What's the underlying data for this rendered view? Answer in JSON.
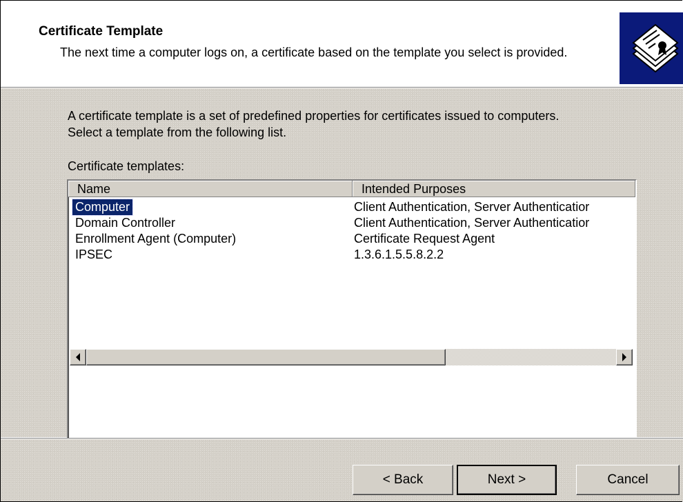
{
  "header": {
    "title": "Certificate Template",
    "subtitle": "The next time a computer logs on, a certificate based on the template you select is provided.",
    "icon": "certificate-stack-icon"
  },
  "main": {
    "intro": "A certificate template is a set of predefined properties for certificates issued to computers. Select a template from the following list.",
    "list_label": "Certificate templates:",
    "columns": [
      "Name",
      "Intended Purposes"
    ],
    "rows": [
      {
        "name": "Computer",
        "purposes": "Client Authentication, Server Authenticatior",
        "selected": true
      },
      {
        "name": "Domain Controller",
        "purposes": "Client Authentication, Server Authenticatior",
        "selected": false
      },
      {
        "name": "Enrollment Agent (Computer)",
        "purposes": "Certificate Request Agent",
        "selected": false
      },
      {
        "name": "IPSEC",
        "purposes": "1.3.6.1.5.5.8.2.2",
        "selected": false
      }
    ]
  },
  "buttons": {
    "back": "< Back",
    "next": "Next >",
    "cancel": "Cancel"
  },
  "colors": {
    "selection": "#0a246a",
    "face": "#d4d0c8",
    "icon_bg": "#0b1a7a"
  }
}
